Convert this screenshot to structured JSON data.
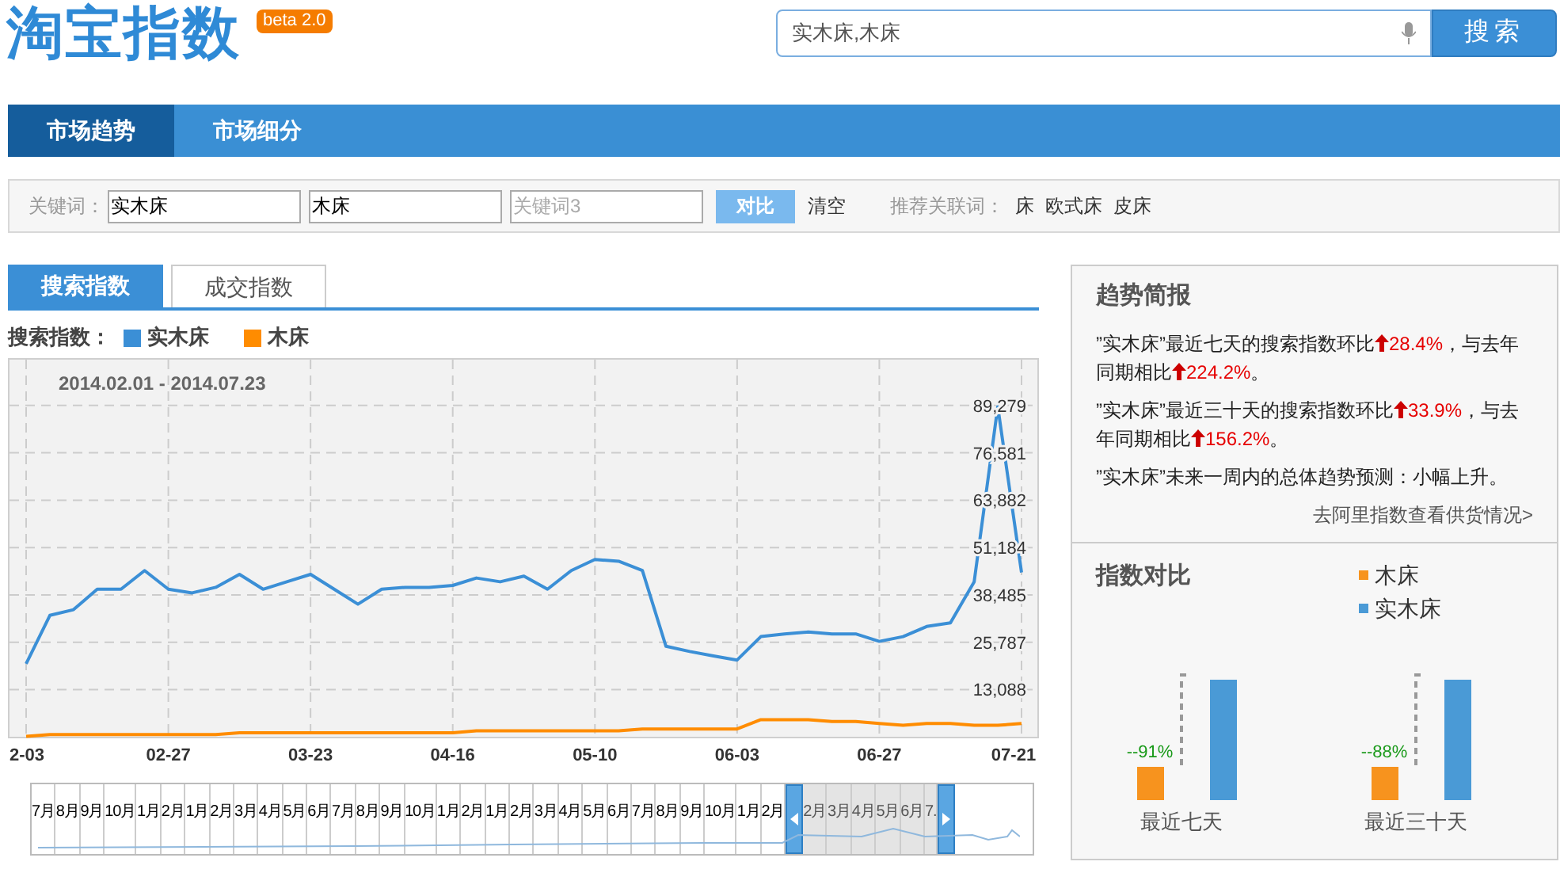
{
  "header": {
    "logo": "淘宝指数",
    "badge": "beta 2.0",
    "search": {
      "value": "实木床,木床"
    },
    "search_button": "搜索"
  },
  "nav": [
    {
      "label": "市场趋势",
      "selected": true
    },
    {
      "label": "市场细分",
      "selected": false
    }
  ],
  "keyword_bar": {
    "label": "关键词：",
    "fields": [
      {
        "value": "实木床"
      },
      {
        "value": "木床"
      },
      {
        "placeholder": "关键词3"
      }
    ],
    "compare_button": "对比",
    "clear_link": "清空",
    "related_label": "推荐关联词：",
    "related": [
      "床",
      "欧式床",
      "皮床"
    ]
  },
  "index_tabs": [
    {
      "label": "搜索指数",
      "selected": true
    },
    {
      "label": "成交指数",
      "selected": false
    }
  ],
  "legend": {
    "label": "搜索指数："
  },
  "chart": {
    "date_range": "2014.02.01 - 2014.07.23",
    "chart_data": {
      "type": "line",
      "grid": true,
      "categories": [
        "2-03",
        null,
        null,
        null,
        null,
        null,
        "02-27",
        null,
        null,
        null,
        null,
        null,
        "03-23",
        null,
        null,
        null,
        null,
        null,
        "04-16",
        null,
        null,
        null,
        null,
        null,
        "05-10",
        null,
        null,
        null,
        null,
        null,
        "06-03",
        null,
        null,
        null,
        null,
        null,
        "06-27",
        null,
        null,
        null,
        null,
        null,
        "07-21"
      ],
      "yticks": [
        {
          "value": 13088,
          "label": "13,088"
        },
        {
          "value": 25787,
          "label": "25,787"
        },
        {
          "value": 38485,
          "label": "38,485"
        },
        {
          "value": 51184,
          "label": "51,184"
        },
        {
          "value": 63882,
          "label": "63,882"
        },
        {
          "value": 76581,
          "label": "76,581"
        },
        {
          "value": 89279,
          "label": "89,279"
        }
      ],
      "ylim": [
        0,
        102000
      ],
      "series": [
        {
          "name": "实木床",
          "color": "#3b8fd6",
          "values": [
            20000,
            33000,
            34500,
            40000,
            40000,
            45000,
            40000,
            39000,
            40500,
            44000,
            40000,
            42000,
            44000,
            40000,
            36000,
            40000,
            40500,
            40500,
            41000,
            43000,
            42000,
            43500,
            40000,
            45000,
            48000,
            47500,
            45000,
            24700,
            23300,
            22100,
            21000,
            27300,
            28000,
            28500,
            28000,
            28000,
            26000,
            27300,
            30000,
            31000,
            42000,
            89000,
            44500
          ]
        },
        {
          "name": "木床",
          "color": "#ff8c00",
          "values": [
            500,
            1000,
            1000,
            1000,
            1000,
            1000,
            1000,
            1000,
            1000,
            1500,
            1500,
            1500,
            1500,
            1500,
            1500,
            1500,
            1500,
            1500,
            1500,
            2000,
            2000,
            2000,
            2000,
            2000,
            2000,
            2000,
            2500,
            2500,
            2500,
            2500,
            2500,
            5000,
            5000,
            5000,
            4500,
            4500,
            4000,
            3500,
            4000,
            4000,
            3500,
            3500,
            4000
          ]
        }
      ]
    },
    "navigator": {
      "labels": [
        "7月",
        "8月",
        "9月",
        "10月",
        "1月",
        "2月",
        "1月",
        "2月",
        "3月",
        "4月",
        "5月",
        "6月",
        "7月",
        "8月",
        "9月",
        "10月",
        "1月",
        "2月",
        "1月",
        "2月",
        "3月",
        "4月",
        "5月",
        "6月",
        "7月",
        "8月",
        "9月",
        "10月",
        "1月",
        "2月"
      ],
      "selected_labels": [
        "2月",
        "3月",
        "4月",
        "5月",
        "6月",
        "7."
      ]
    }
  },
  "report": {
    "title": "趋势简报",
    "paragraphs": [
      [
        {
          "kind": "plain",
          "text": "”实木床”最近七天的搜索指数环比"
        },
        {
          "kind": "up",
          "text": "28.4%"
        },
        {
          "kind": "plain",
          "text": "，与去年同期相比"
        },
        {
          "kind": "up",
          "text": "224.2%"
        },
        {
          "kind": "plain",
          "text": "。"
        }
      ],
      [
        {
          "kind": "plain",
          "text": "”实木床”最近三十天的搜索指数环比"
        },
        {
          "kind": "up",
          "text": "33.9%"
        },
        {
          "kind": "plain",
          "text": "，与去年同期相比"
        },
        {
          "kind": "up",
          "text": "156.2%"
        },
        {
          "kind": "plain",
          "text": "。"
        }
      ],
      [
        {
          "kind": "plain",
          "text": "”实木床”未来一周内的总体趋势预测：小幅上升。"
        }
      ]
    ],
    "link": "去阿里指数查看供货情况>"
  },
  "comparison": {
    "title": "指数对比",
    "legend": [
      {
        "label": "木床",
        "color": "#f7931e"
      },
      {
        "label": "实木床",
        "color": "#4a9ad6"
      }
    ],
    "groups": [
      {
        "label": "最近七天",
        "change": "--91%"
      },
      {
        "label": "最近三十天",
        "change": "--88%"
      }
    ]
  }
}
